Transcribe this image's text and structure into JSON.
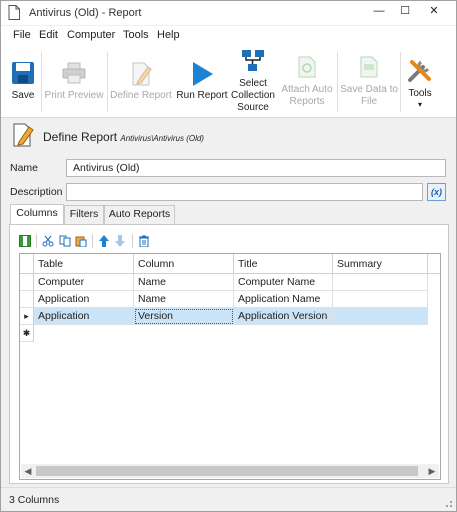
{
  "window": {
    "title": "Antivirus (Old) - Report",
    "minimize": "—",
    "maximize": "☐",
    "close": "✕"
  },
  "menu": [
    "File",
    "Edit",
    "Computer",
    "Tools",
    "Help"
  ],
  "ribbon": {
    "save": "Save",
    "print_preview": "Print Preview",
    "define_report": "Define Report",
    "run_report": "Run Report",
    "select_collection_source": [
      "Select",
      "Collection",
      "Source"
    ],
    "attach_auto_reports": [
      "Attach Auto",
      "Reports"
    ],
    "save_data_to_file": [
      "Save Data to",
      "File"
    ],
    "tools": "Tools",
    "tools_arrow": "▾"
  },
  "header": {
    "title": "Define Report",
    "path": "Antivirus\\Antivirus (Old)"
  },
  "form": {
    "name_label": "Name",
    "name_value": "Antivirus (Old)",
    "description_label": "Description",
    "description_value": "",
    "fx_label": "(x)"
  },
  "tabs": [
    "Columns",
    "Filters",
    "Auto Reports"
  ],
  "toolbar_icons": [
    "columns-icon",
    "cut-icon",
    "copy-icon",
    "paste-icon",
    "move-up-icon",
    "move-down-icon",
    "delete-icon"
  ],
  "grid": {
    "columns": [
      "Table",
      "Column",
      "Title",
      "Summary"
    ],
    "rows": [
      {
        "table": "Computer",
        "column": "Name",
        "title": "Computer Name",
        "summary": ""
      },
      {
        "table": "Application",
        "column": "Name",
        "title": "Application Name",
        "summary": ""
      },
      {
        "table": "Application",
        "column": "Version",
        "title": "Application Version",
        "summary": ""
      }
    ],
    "current_row_marker": "▸",
    "new_row_marker": "✱"
  },
  "status": {
    "text": "3 Columns"
  }
}
